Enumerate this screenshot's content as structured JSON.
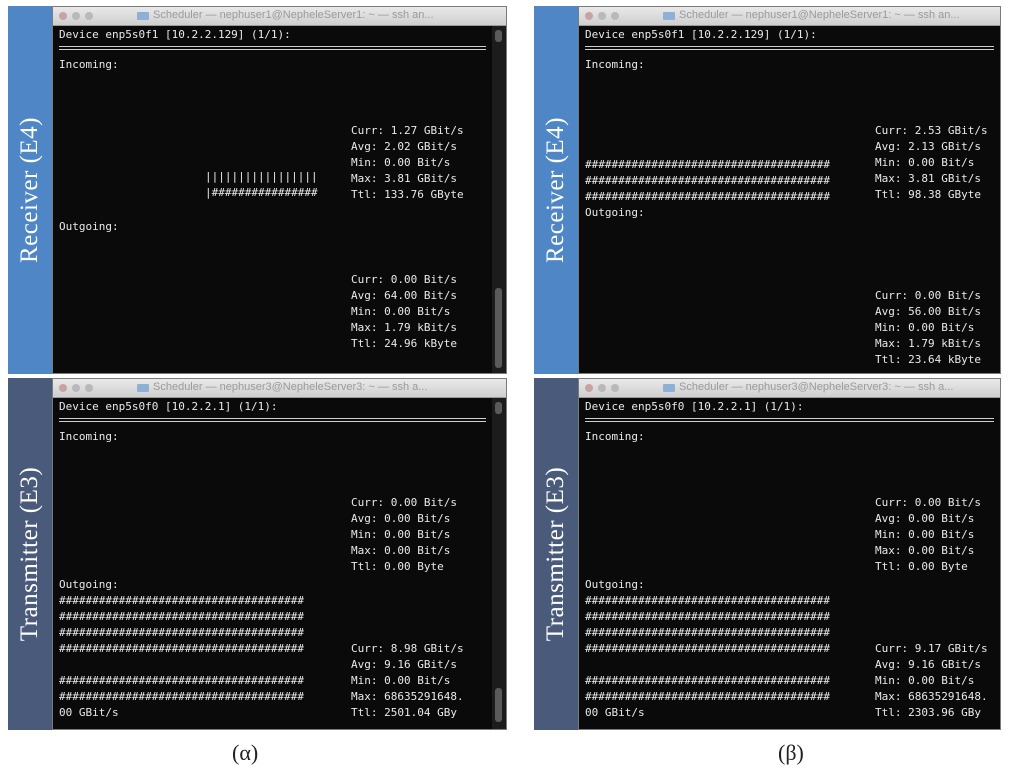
{
  "captions": {
    "left": "(α)",
    "right": "(β)"
  },
  "labels": {
    "receiver": "Receiver (E4)",
    "transmitter": "Transmitter (E3)"
  },
  "panels": {
    "a_rx": {
      "title": "Scheduler — nephuser1@NepheleServer1: ~ — ssh an...",
      "device": "Device enp5s0f1 [10.2.2.129] (1/1):",
      "incoming_label": "Incoming:",
      "outgoing_label": "Outgoing:",
      "inc_stats": [
        "Curr: 1.27 GBit/s",
        "Avg: 2.02 GBit/s",
        "Min: 0.00 Bit/s",
        "Max: 3.81 GBit/s",
        "Ttl: 133.76 GByte"
      ],
      "inc_graph": [
        "|||||||||||||||||",
        "|################"
      ],
      "out_stats": [
        "Curr: 0.00 Bit/s",
        "Avg: 64.00 Bit/s",
        "Min: 0.00 Bit/s",
        "Max: 1.79 kBit/s",
        "Ttl: 24.96 kByte"
      ]
    },
    "b_rx": {
      "title": "Scheduler — nephuser1@NepheleServer1: ~ — ssh an...",
      "device": "Device enp5s0f1 [10.2.2.129] (1/1):",
      "incoming_label": "Incoming:",
      "outgoing_label": "Outgoing:",
      "inc_stats": [
        "Curr: 2.53 GBit/s",
        "Avg: 2.13 GBit/s",
        "Min: 0.00 Bit/s",
        "Max: 3.81 GBit/s",
        "Ttl: 98.38 GByte"
      ],
      "inc_graph": [
        "#####################################",
        "#####################################",
        "#####################################"
      ],
      "out_stats": [
        "Curr: 0.00 Bit/s",
        "Avg: 56.00 Bit/s",
        "Min: 0.00 Bit/s",
        "Max: 1.79 kBit/s",
        "Ttl: 23.64 kByte"
      ]
    },
    "a_tx": {
      "title": "Scheduler — nephuser3@NepheleServer3: ~ — ssh a...",
      "device": "Device enp5s0f0 [10.2.2.1] (1/1):",
      "incoming_label": "Incoming:",
      "outgoing_label": "Outgoing:",
      "inc_stats": [
        "Curr: 0.00 Bit/s",
        "Avg: 0.00 Bit/s",
        "Min: 0.00 Bit/s",
        "Max: 0.00 Bit/s",
        "Ttl: 0.00 Byte"
      ],
      "out_graph": [
        "#####################################",
        "#####################################",
        "#####################################",
        "#####################################",
        "",
        "#####################################",
        "#####################################"
      ],
      "out_stats": [
        "Curr: 8.98 GBit/s",
        "Avg: 9.16 GBit/s",
        "Min: 0.00 Bit/s",
        "Max: 68635291648.",
        "Ttl: 2501.04 GBy"
      ],
      "out_tail": "00 GBit/s"
    },
    "b_tx": {
      "title": "Scheduler — nephuser3@NepheleServer3: ~ — ssh a...",
      "device": "Device enp5s0f0 [10.2.2.1] (1/1):",
      "incoming_label": "Incoming:",
      "outgoing_label": "Outgoing:",
      "inc_stats": [
        "Curr: 0.00 Bit/s",
        "Avg: 0.00 Bit/s",
        "Min: 0.00 Bit/s",
        "Max: 0.00 Bit/s",
        "Ttl: 0.00 Byte"
      ],
      "out_graph": [
        "#####################################",
        "#####################################",
        "#####################################",
        "#####################################",
        "",
        "#####################################",
        "#####################################"
      ],
      "out_stats": [
        "Curr: 9.17 GBit/s",
        "Avg: 9.16 GBit/s",
        "Min: 0.00 Bit/s",
        "Max: 68635291648.",
        "Ttl: 2303.96 GBy"
      ],
      "out_tail": "00 GBit/s"
    }
  }
}
